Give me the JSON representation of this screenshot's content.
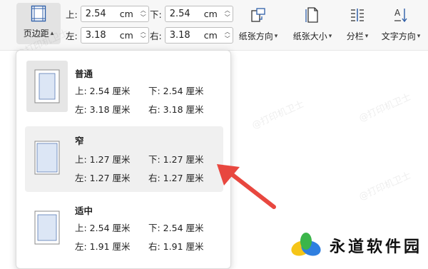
{
  "ribbon": {
    "margins_label": "页边距",
    "top_label": "上:",
    "top_value": "2.54",
    "top_unit": "cm",
    "bottom_label": "下:",
    "bottom_value": "2.54",
    "bottom_unit": "cm",
    "left_label": "左:",
    "left_value": "3.18",
    "left_unit": "cm",
    "right_label": "右:",
    "right_value": "3.18",
    "right_unit": "cm",
    "orientation_label": "纸张方向",
    "size_label": "纸张大小",
    "columns_label": "分栏",
    "text_direction_label": "文字方向"
  },
  "presets": [
    {
      "name": "普通",
      "top": "上: 2.54 厘米",
      "bottom": "下: 2.54 厘米",
      "left": "左: 3.18 厘米",
      "right": "右: 3.18 厘米"
    },
    {
      "name": "窄",
      "top": "上: 1.27 厘米",
      "bottom": "下: 1.27 厘米",
      "left": "左: 1.27 厘米",
      "right": "右: 1.27 厘米"
    },
    {
      "name": "适中",
      "top": "上: 2.54 厘米",
      "bottom": "下: 2.54 厘米",
      "left": "左: 1.91 厘米",
      "right": "右: 1.91 厘米"
    }
  ],
  "brand": {
    "name": "永道软件园"
  },
  "watermark": "@打印机卫士",
  "colors": {
    "arrow": "#e8473f",
    "logo_green": "#3bb54a",
    "logo_yellow": "#f5c518",
    "logo_blue": "#2f7fe0",
    "highlight": "#f0f0f0"
  }
}
